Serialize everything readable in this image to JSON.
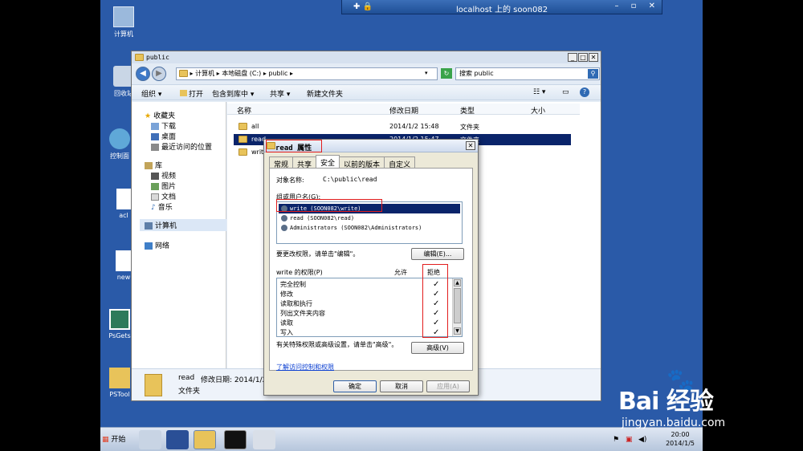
{
  "rdp": {
    "title": "localhost 上的 soon082"
  },
  "desktop": {
    "icons": [
      {
        "label": "计算机"
      },
      {
        "label": "回收站"
      },
      {
        "label": "控制面"
      },
      {
        "label": "acl"
      },
      {
        "label": "new"
      },
      {
        "label": "PsGets"
      },
      {
        "label": "PSTool"
      }
    ]
  },
  "explorer": {
    "title": "public",
    "address": "▸ 计算机 ▸ 本地磁盘 (C:) ▸ public ▸",
    "search_placeholder": "搜索 public",
    "toolbar": {
      "organize": "组织 ▾",
      "open": "打开",
      "include": "包含到库中 ▾",
      "share": "共享 ▾",
      "new_folder": "新建文件夹"
    },
    "nav": {
      "favorites": "收藏夹",
      "downloads": "下载",
      "desktop": "桌面",
      "recent": "最近访问的位置",
      "libraries": "库",
      "videos": "视频",
      "pictures": "图片",
      "documents": "文档",
      "music": "音乐",
      "computer": "计算机",
      "network": "网络"
    },
    "columns": {
      "name": "名称",
      "modified": "修改日期",
      "type": "类型",
      "size": "大小"
    },
    "files": [
      {
        "name": "all",
        "modified": "2014/1/2 15:48",
        "type": "文件夹"
      },
      {
        "name": "read",
        "modified": "2014/1/2 15:47",
        "type": "文件夹"
      },
      {
        "name": "writ",
        "modified": "",
        "type": ""
      }
    ],
    "details": {
      "name": "read",
      "modified": "修改日期: 2014/1/2",
      "type": "文件夹"
    }
  },
  "dialog": {
    "title": "read 属性",
    "tabs": [
      "常规",
      "共享",
      "安全",
      "以前的版本",
      "自定义"
    ],
    "object_label": "对象名称:",
    "object_path": "C:\\public\\read",
    "group_label": "组或用户名(G):",
    "users": [
      "write (SOON082\\write)",
      "read (SOON082\\read)",
      "Administrators (SOON082\\Administrators)"
    ],
    "change_hint": "要更改权限，请单击\"编辑\"。",
    "edit_button": "编辑(E)...",
    "perm_header": "write 的权限(P)",
    "allow_label": "允许",
    "deny_label": "拒绝",
    "permissions": [
      {
        "name": "完全控制",
        "deny": "✓"
      },
      {
        "name": "修改",
        "deny": "✓"
      },
      {
        "name": "读取和执行",
        "deny": "✓"
      },
      {
        "name": "列出文件夹内容",
        "deny": "✓"
      },
      {
        "name": "读取",
        "deny": "✓"
      },
      {
        "name": "写入",
        "deny": "✓"
      }
    ],
    "advanced_hint": "有关特殊权限或高级设置，请单击\"高级\"。",
    "advanced_button": "高级(V)",
    "learn_link": "了解访问控制和权限",
    "ok": "确定",
    "cancel": "取消",
    "apply": "应用(A)"
  },
  "taskbar": {
    "start": "开始",
    "time": "20:00",
    "date": "2014/1/5"
  },
  "watermark": {
    "logo": "Bai 经验",
    "url": "jingyan.baidu.com"
  },
  "colors": {
    "desktop": "#2a5aa8",
    "selection": "#0a246a",
    "highlight": "#e21d1d"
  }
}
